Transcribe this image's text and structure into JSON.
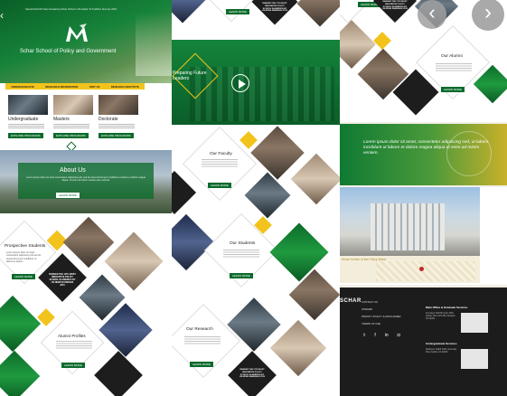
{
  "col1": {
    "topbar": "Special Fall 100 Years Sustaining Schar School in the Nation To Tradition Summer 2019",
    "logo_text": "Schar School of Policy and Government",
    "nav": [
      "UNDERGRADUATE",
      "RESEARCH INFORMATION",
      "VISIT US",
      "RESEARCH INSTITUTE"
    ],
    "programs": [
      {
        "label": "Undergraduate",
        "button": "EXPLORE PROGRAMS"
      },
      {
        "label": "Masters",
        "button": "EXPLORE PROGRAMS"
      },
      {
        "label": "Doctorate",
        "button": "EXPLORE PROGRAMS"
      }
    ],
    "about_title": "About Us",
    "about_text": "Lorem ipsum dolor sit amet consectetur adipiscing elit, sed do eiusmod tempor incididunt ut labore et dolore magna aliqua. Ut enim ad minim veniam quis nostrud.",
    "about_button": "LEARN MORE",
    "prospective_title": "Prospective Students",
    "prospective_text": "Lorem ipsum dolor sit amet consectetur adipiscing elit sed do eiusmod tempor incididunt ut labore et dolore.",
    "prospective_button": "LEARN MORE",
    "ranked_text": "RANKED THE 11TH MOST INNOVATIVE POLICY SCHOOL IN AMERICA BY US NEWS RANKINGS 2015",
    "alumni_title": "Alumni Profiles",
    "alumni_button": "LEARN MORE"
  },
  "col2": {
    "ranked_text": "RANKED THE 11TH MOST INNOVATIVE POLICY SCHOOL IN AMERICA BY US NEWS RANKINGS 2015",
    "video_text": "Preparing Future Leaders",
    "faculty_title": "Our Faculty",
    "faculty_button": "LEARN MORE",
    "students_title": "Our Students",
    "students_button": "LEARN MORE",
    "research_title": "Our Research",
    "research_button": "LEARN MORE"
  },
  "col3": {
    "alumni_title": "Our Alumni",
    "alumni_button": "LEARN MORE",
    "ranked_text": "RANKED THE 11TH MOST INNOVATIVE POLICY SCHOOL IN AMERICA BY US NEWS RANKINGS 2015",
    "quote": "Lorem ipsum dolor sit amet, consectetur adipiscing sed, ut labore incididunt ut labore et dolore magna aliqua ut enim ad minim veniam.",
    "map_caption": "Schar Center of the Policy World",
    "footer_logo": "SCHAR",
    "footer_links": [
      "CONTACT US",
      "SITEMAP",
      "PRIVACY POLICY & DISCLAIMER",
      "TERMS OF USE"
    ],
    "footer_main_title": "Main Office & Graduate Services",
    "footer_main_addr": "Founders Hall 5th Floor 3351 Fairfax Drive MS 3B1 Arlington VA 22201",
    "footer_undergrad_title": "Undergraduate Services",
    "footer_undergrad_addr": "Robinson Hall B 4400 University Drive Fairfax VA 22030"
  },
  "colors": {
    "green": "#0b6b2c",
    "yellow": "#f2c31b",
    "dark": "#1d1d1d"
  },
  "icons": [
    "chevron-left-icon",
    "chevron-right-icon",
    "play-icon",
    "twitter-icon",
    "facebook-icon",
    "linkedin-icon",
    "instagram-icon"
  ]
}
